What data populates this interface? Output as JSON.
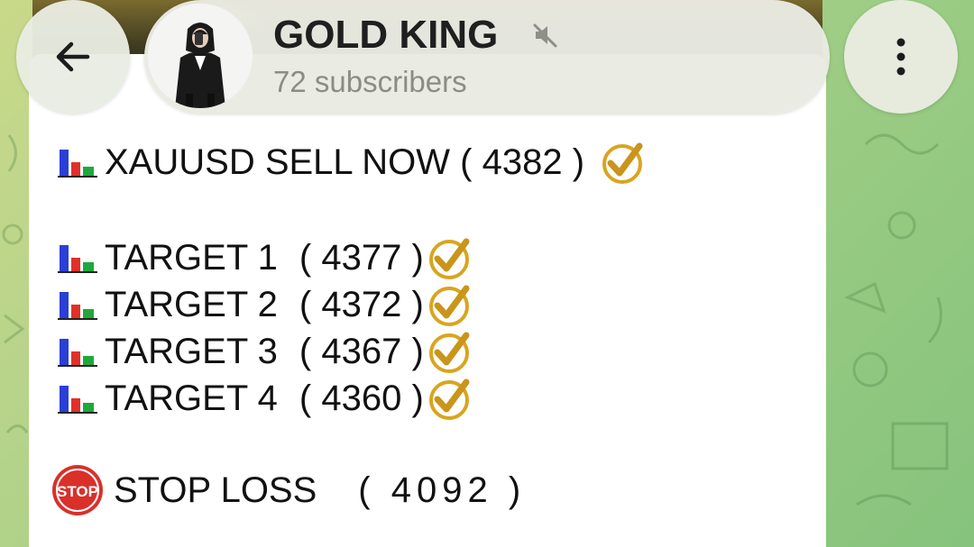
{
  "header": {
    "title": "GOLD KING",
    "subscribers": "72 subscribers",
    "muted": true
  },
  "message": {
    "signal": {
      "icon": "bar-chart-icon",
      "text": "XAUUSD SELL NOW ( 4382 )",
      "status_icon": "gold-check-icon"
    },
    "targets": [
      {
        "label": "TARGET 1",
        "value": "( 4377 )",
        "hit": true
      },
      {
        "label": "TARGET 2",
        "value": "( 4372 )",
        "hit": true
      },
      {
        "label": "TARGET 3",
        "value": "( 4367 )",
        "hit": true
      },
      {
        "label": "TARGET 4",
        "value": "( 4360 )",
        "hit": true
      }
    ],
    "stop_loss": {
      "icon": "stop-sign-icon",
      "icon_text": "STOP",
      "label": "STOP LOSS",
      "value": "( 4092 )"
    }
  },
  "colors": {
    "wallpaper_start": "#c9d98a",
    "wallpaper_end": "#86c37c",
    "bubble": "#ffffff",
    "check_gold": "#d9a520",
    "stop_red": "#d9302a",
    "chart_blue": "#2a3fd6",
    "chart_red": "#e0302a",
    "chart_green": "#1ea83c"
  }
}
